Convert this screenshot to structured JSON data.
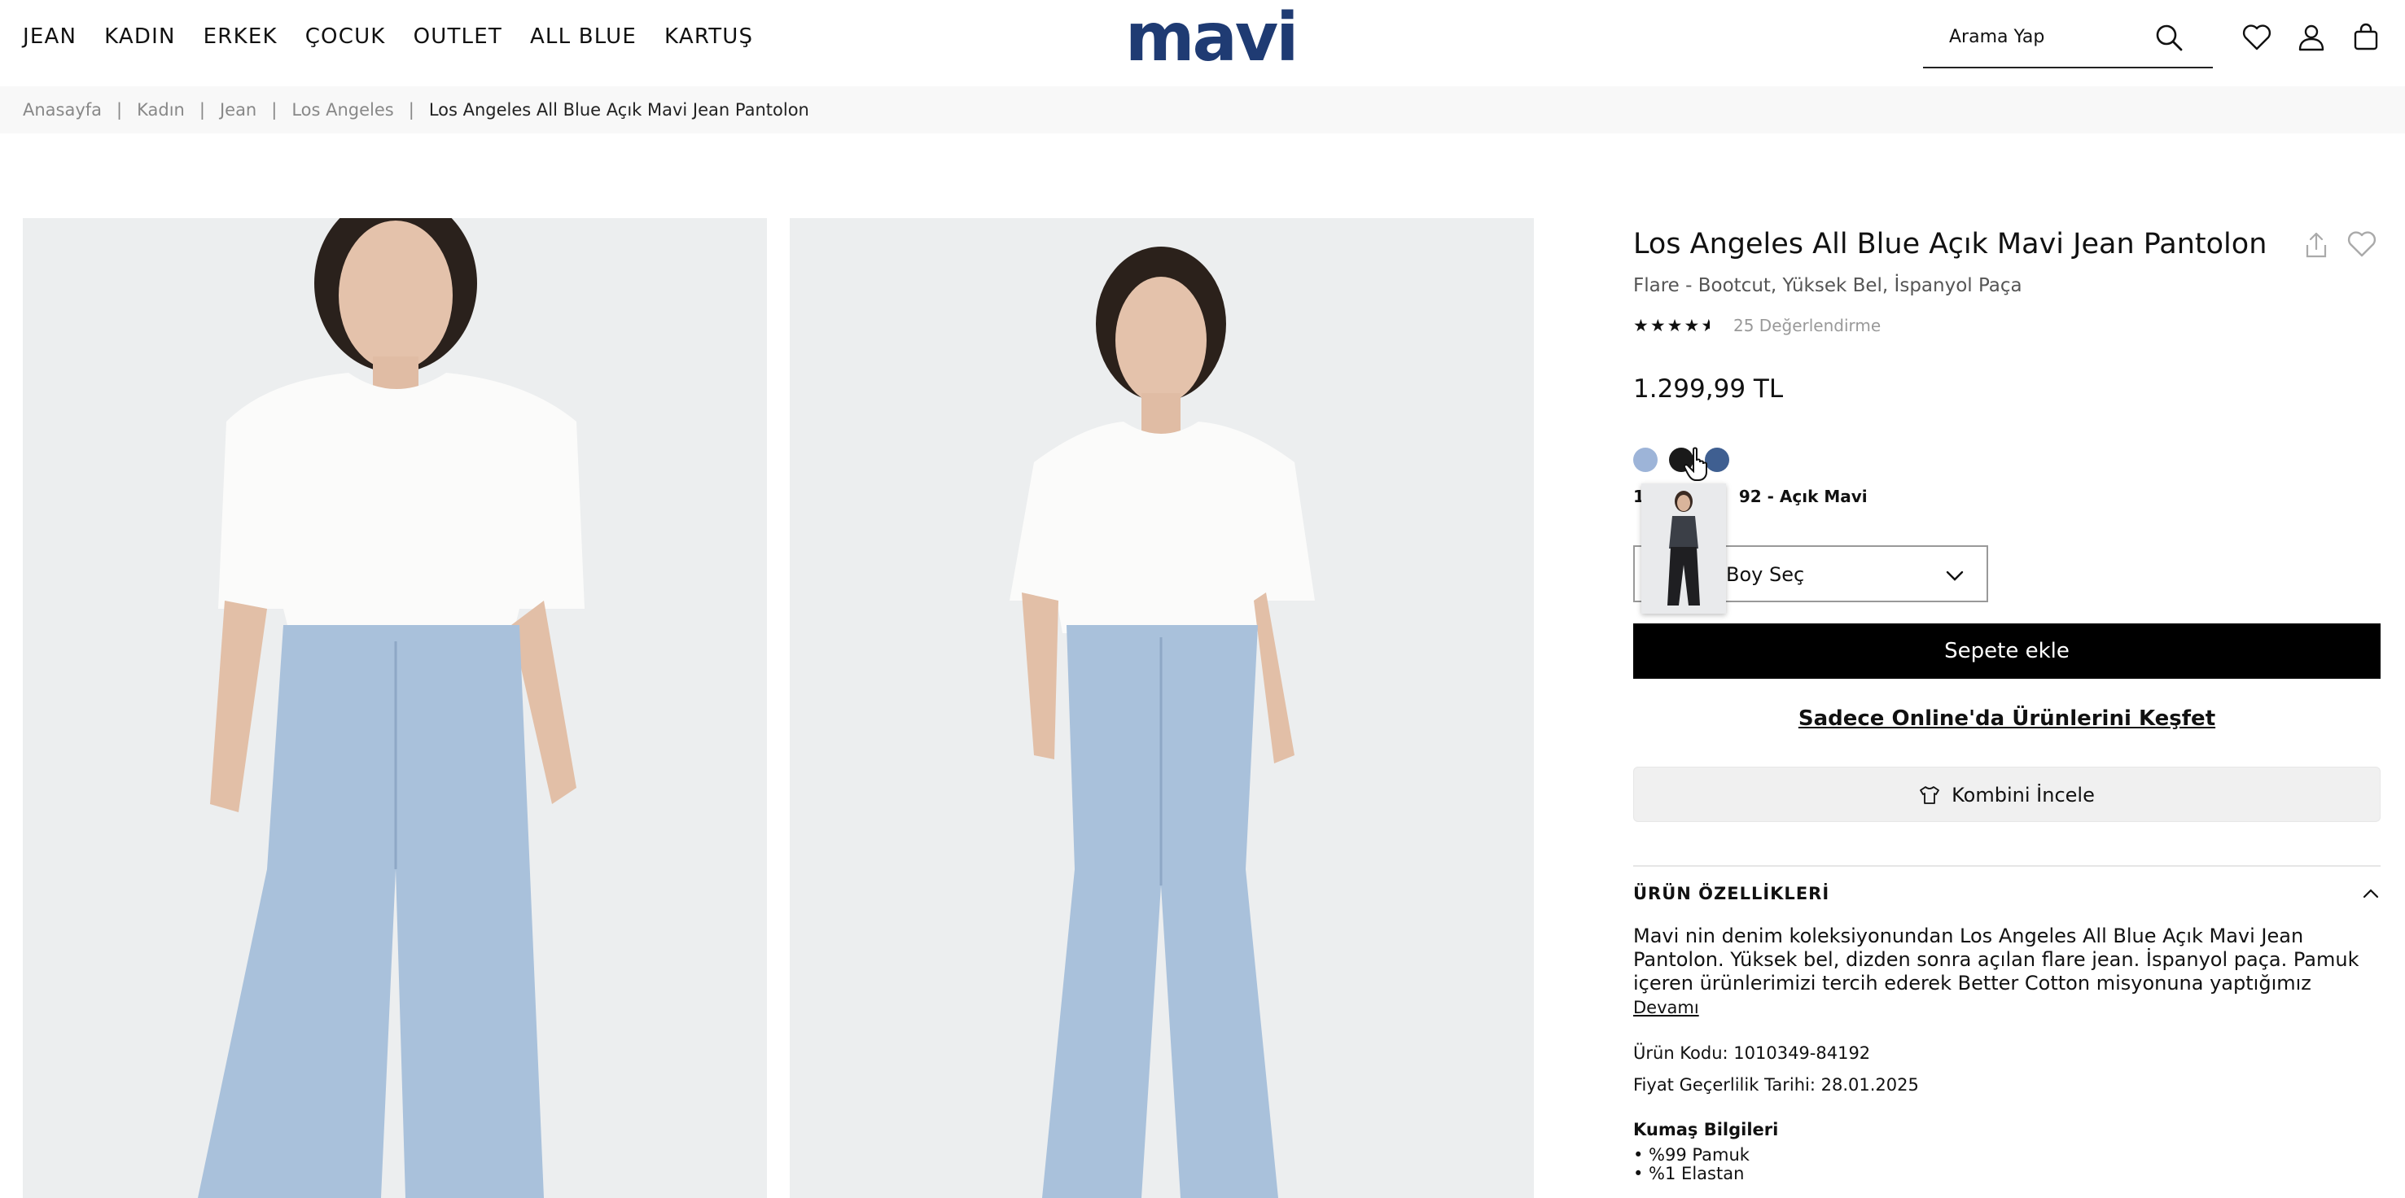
{
  "header": {
    "nav": [
      {
        "label": "JEAN"
      },
      {
        "label": "KADIN"
      },
      {
        "label": "ERKEK"
      },
      {
        "label": "ÇOCUK"
      },
      {
        "label": "OUTLET"
      },
      {
        "label": "ALL BLUE"
      },
      {
        "label": "KARTUŞ"
      }
    ],
    "logo": "mavi",
    "search_placeholder": "Arama Yap",
    "icons": [
      "search-icon",
      "heart-icon",
      "user-icon",
      "bag-icon"
    ]
  },
  "breadcrumb": {
    "items": [
      "Anasayfa",
      "Kadın",
      "Jean",
      "Los Angeles"
    ],
    "current": "Los Angeles All Blue Açık Mavi Jean Pantolon"
  },
  "product": {
    "title": "Los Angeles All Blue Açık Mavi Jean Pantolon",
    "subtitle": "Flare - Bootcut, Yüksek Bel, İspanyol Paça",
    "rating": 4.5,
    "rating_count": "25 Değerlendirme",
    "price": "1.299,99 TL",
    "swatches": [
      {
        "color": "#9db4d8"
      },
      {
        "color": "#1a1a1a"
      },
      {
        "color": "#3f5f91"
      }
    ],
    "color_label_left": "10",
    "color_label_right": "92 - Açık Mavi",
    "size_label": "Boy Seç",
    "add_to_cart": "Sepete ekle",
    "online_link": "Sadece Online'da Ürünlerini Keşfet",
    "kombin": "Kombini İncele",
    "section_title": "ÜRÜN ÖZELLİKLERİ",
    "description": "Mavi nin denim koleksiyonundan Los Angeles All Blue Açık Mavi Jean Pantolon. Yüksek bel, dizden sonra açılan flare jean. İspanyol paça. Pamuk içeren ürünlerimizi tercih ederek Better Cotton misyonuna yaptığımız yatırımı",
    "more": "Devamı",
    "code": "Ürün Kodu: 1010349-84192",
    "price_validity": "Fiyat Geçerlilik Tarihi: 28.01.2025",
    "fabric_title": "Kumaş Bilgileri",
    "fabric": [
      "• %99 Pamuk",
      "• %1 Elastan"
    ]
  },
  "colors": {
    "logo": "#1f3b73",
    "button": "#000000"
  }
}
